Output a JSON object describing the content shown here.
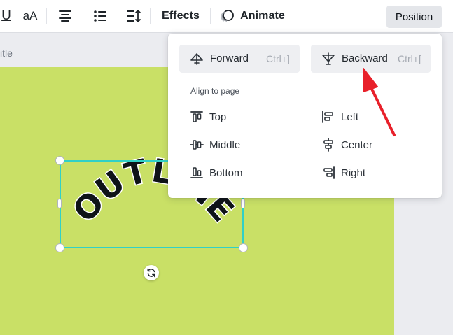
{
  "toolbar": {
    "underline_label": "U",
    "case_label": "aA",
    "effects_label": "Effects",
    "animate_label": "Animate",
    "position_label": "Position"
  },
  "canvas": {
    "title_fragment": "itle",
    "text_content": "OUTLINE",
    "page_color": "#c9e066",
    "selection_color": "#31d0c7"
  },
  "position_menu": {
    "forward": {
      "label": "Forward",
      "shortcut": "Ctrl+]"
    },
    "backward": {
      "label": "Backward",
      "shortcut": "Ctrl+["
    },
    "align_section_label": "Align to page",
    "align_items": [
      {
        "label": "Top",
        "icon": "align-top-icon"
      },
      {
        "label": "Left",
        "icon": "align-left-icon"
      },
      {
        "label": "Middle",
        "icon": "align-middle-icon"
      },
      {
        "label": "Center",
        "icon": "align-center-icon"
      },
      {
        "label": "Bottom",
        "icon": "align-bottom-icon"
      },
      {
        "label": "Right",
        "icon": "align-right-icon"
      }
    ]
  },
  "annotation": {
    "arrow_color": "#e8202a"
  }
}
